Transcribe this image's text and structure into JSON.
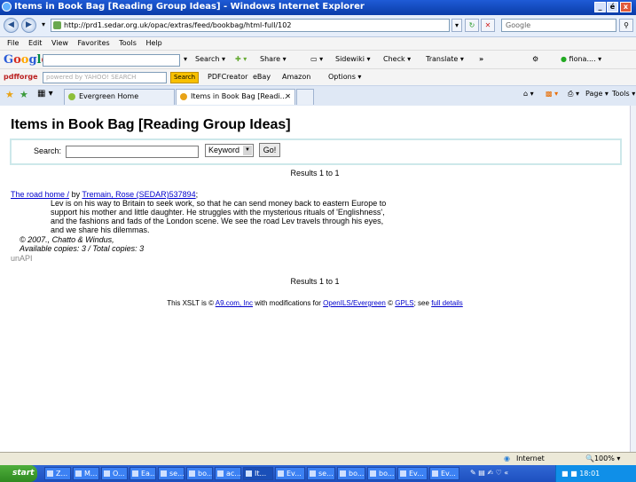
{
  "window": {
    "title": "Items in Book Bag [Reading Group Ideas] - Windows Internet Explorer",
    "minimize": "_",
    "maximize": "é",
    "close": "x"
  },
  "address_bar": {
    "url": "http://prd1.sedar.org.uk/opac/extras/feed/bookbag/html-full/102",
    "search_placeholder": "Google"
  },
  "menu": [
    "File",
    "Edit",
    "View",
    "Favorites",
    "Tools",
    "Help"
  ],
  "google_toolbar": {
    "logo": "Google",
    "items": [
      "Search ▾",
      "Share ▾",
      "Sidewiki ▾",
      "Check ▾",
      "Translate ▾",
      "»",
      "fiona.... ▾"
    ]
  },
  "yahoo_toolbar": {
    "logo": "pdfforge",
    "search_box": "powered by YAHOO! SEARCH",
    "search_button": "Search",
    "items": [
      "PDFCreator",
      "eBay",
      "Amazon",
      "Options ▾"
    ]
  },
  "tabs": [
    {
      "label": "Evergreen Home"
    },
    {
      "label": "Items in Book Bag [Readi..."
    }
  ],
  "command_bar": [
    "Page ▾",
    "Tools ▾"
  ],
  "page": {
    "heading": "Items in Book Bag [Reading Group Ideas]",
    "search_label": "Search:",
    "search_value": "",
    "search_type": "Keyword",
    "go_button": "Go!",
    "results_top": "Results 1 to 1",
    "results_bottom": "Results 1 to 1",
    "record": {
      "title": "The road home /",
      "by": "by",
      "author": "Tremain, Rose (SEDAR)537894",
      "description": "Lev is on his way to Britain to seek work, so that he can send money back to eastern Europe to support his mother and little daughter. He struggles with the mysterious rituals of 'Englishness', and the fashions and fads of the London scene. We see the road Lev travels through his eyes, and we share his dilemmas.",
      "publisher": "© 2007., Chatto & Windus,",
      "copies": "Available copies: 3 / Total copies: 3",
      "unapi": "unAPI"
    },
    "footer": {
      "prefix": "This XSLT is ©",
      "link1": "A9.com, Inc",
      "mid1": "with modifications for",
      "link2": "OpenILS/Evergreen",
      "mid2": "©",
      "link3": "GPLS",
      "mid3": "; see",
      "link4": "full details"
    }
  },
  "status_bar": {
    "zone": "Internet",
    "zoom": "100%"
  },
  "taskbar": {
    "start": "start",
    "tasks": [
      "Z...",
      "M...",
      "O...",
      "Ea...",
      "se...",
      "bo...",
      "ac...",
      "It...",
      "Ev...",
      "se...",
      "bo...",
      "bo...",
      "Ev...",
      "Ev..."
    ],
    "clock": "18:01"
  },
  "colors": {
    "titlebar": "#0a3ca8",
    "link": "#0000cc",
    "search_border": "#cde8ea",
    "taskbar": "#1e4fbf",
    "start": "#2f8a21"
  }
}
